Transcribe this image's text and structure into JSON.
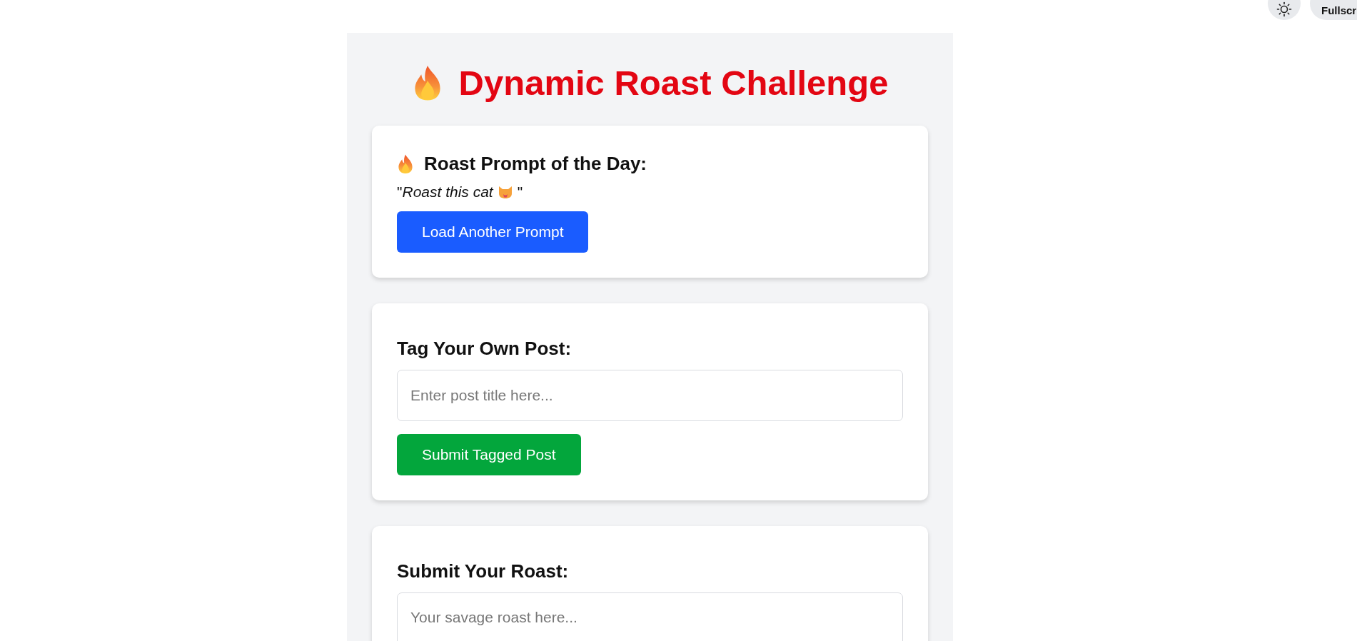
{
  "top_bar": {
    "fullscreen_label": "Fullscr"
  },
  "title": "Dynamic Roast Challenge",
  "prompt_card": {
    "heading": "Roast Prompt of the Day:",
    "prompt": "\"*Roast this cat*",
    "prompt_end": "\"",
    "button": "Load Another Prompt"
  },
  "tag_card": {
    "heading": "Tag Your Own Post:",
    "placeholder": "Enter post title here...",
    "button": "Submit Tagged Post"
  },
  "roast_card": {
    "heading": "Submit Your Roast:",
    "placeholder": "Your savage roast here..."
  }
}
